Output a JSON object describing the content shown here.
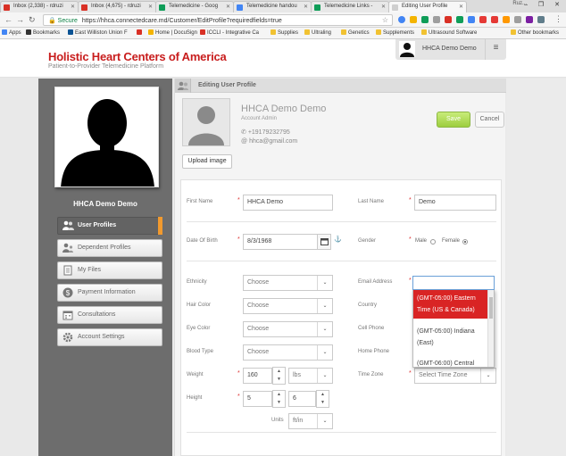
{
  "browser": {
    "tabs": [
      {
        "title": "Inbox (2,338) - rdruzi",
        "color": "#d93025"
      },
      {
        "title": "Inbox (4,675) - rdruzi",
        "color": "#d93025"
      },
      {
        "title": "Telemedicine - Goog",
        "color": "#0f9d58"
      },
      {
        "title": "Telemedicine handou",
        "color": "#4285f4"
      },
      {
        "title": "Telemedicine Links -",
        "color": "#0f9d58"
      },
      {
        "title": "Editing User Profile",
        "color": "#cfcfcf"
      }
    ],
    "window_user": "Ruz...",
    "window_buttons": "– ❐ ✕",
    "url_secure": "Secure",
    "url": "https://hhca.connectedcare.md/Customer/EditProfile?requiredfields=true",
    "bookmarks": [
      {
        "label": "Apps",
        "color": "#4285f4"
      },
      {
        "label": "Bookmarks",
        "color": "#333333"
      },
      {
        "label": "East Williston Union F",
        "color": "#0b5394"
      },
      {
        "label": "",
        "color": "#d93025"
      },
      {
        "label": "Home | DocuSign",
        "color": "#f4b400"
      },
      {
        "label": "ICCLI - Integrative Ca",
        "color": "#d93025"
      },
      {
        "label": "Supplies",
        "color": "#f1c232"
      },
      {
        "label": "Ultraling",
        "color": "#f1c232"
      },
      {
        "label": "Genetics",
        "color": "#f1c232"
      },
      {
        "label": "Supplements",
        "color": "#f1c232"
      },
      {
        "label": "Ultrasound Software",
        "color": "#f1c232"
      }
    ],
    "other_bookmarks": "Other bookmarks"
  },
  "header": {
    "brand": "Holistic Heart Centers of America",
    "tagline": "Patient-to-Provider Telemedicine Platform",
    "user_name": "HHCA Demo Demo",
    "menu_icon": "≡"
  },
  "sidebar": {
    "name": "HHCA Demo Demo",
    "items": [
      {
        "label": "User Profiles",
        "icon": "users-icon",
        "active": true
      },
      {
        "label": "Dependent Profiles",
        "icon": "dependents-icon",
        "active": false
      },
      {
        "label": "My Files",
        "icon": "files-icon",
        "active": false
      },
      {
        "label": "Payment Information",
        "icon": "dollar-icon",
        "active": false
      },
      {
        "label": "Consultations",
        "icon": "calendar-icon",
        "active": false
      },
      {
        "label": "Account Settings",
        "icon": "gear-icon",
        "active": false
      }
    ]
  },
  "panel": {
    "title": "Editing User Profile",
    "name": "HHCA Demo Demo",
    "role": "Account Admin",
    "phone": "+19179232795",
    "email": "hhca@gmail.com",
    "upload_label": "Upload image",
    "save_label": "Save",
    "cancel_label": "Cancel"
  },
  "form": {
    "first_name_label": "First Name",
    "first_name": "HHCA Demo",
    "last_name_label": "Last Name",
    "last_name": "Demo",
    "dob_label": "Date Of Birth",
    "dob": "8/3/1968",
    "gender_label": "Gender",
    "male_label": "Male",
    "female_label": "Female",
    "gender_value": "Female",
    "ethnicity_label": "Ethnicity",
    "hair_label": "Hair Color",
    "eye_label": "Eye Color",
    "blood_label": "Blood Type",
    "choose": "Choose",
    "email_label": "Email Address",
    "country_label": "Country",
    "cell_label": "Cell Phone",
    "home_label": "Home Phone",
    "timezone_label": "Time Zone",
    "timezone_placeholder": "Select Time Zone",
    "weight_label": "Weight",
    "weight": "160",
    "weight_unit": "lbs",
    "height_label": "Height",
    "height_ft": "5",
    "height_in": "6",
    "units_label": "Units",
    "units_value": "ft/in"
  },
  "timezone_options": [
    "(GMT-05:00) Eastern Time (US & Canada)",
    "(GMT-05:00) Indiana (East)",
    "(GMT-06:00) Central"
  ]
}
